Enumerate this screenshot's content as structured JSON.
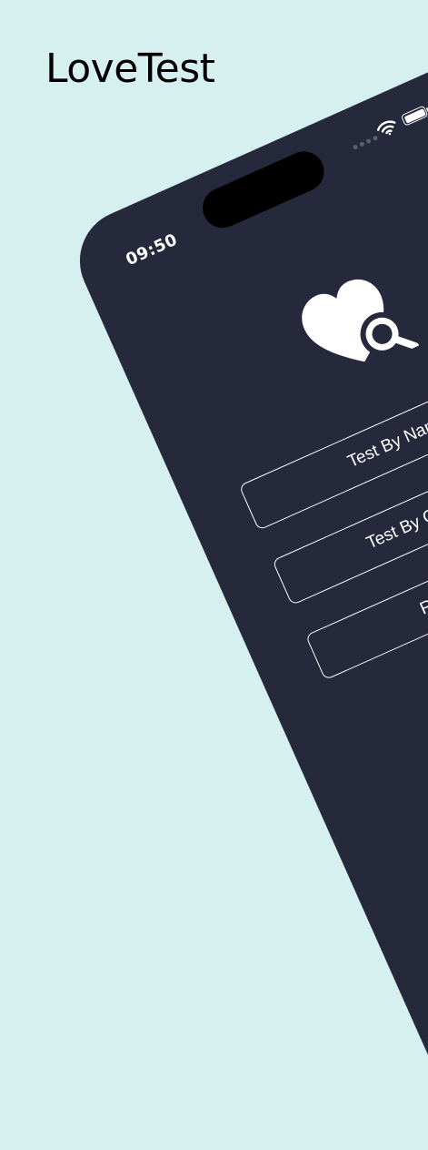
{
  "app": {
    "title": "LoveTest"
  },
  "status_bar": {
    "time": "09:50",
    "battery_percent": 100,
    "icons": [
      "wifi-icon",
      "battery-icon",
      "signal-dots"
    ]
  },
  "logo": {
    "icon": "heart-search-icon"
  },
  "menu": {
    "buttons": [
      {
        "label": "Test By Name"
      },
      {
        "label": "Test By Questions"
      },
      {
        "label": "Relationship"
      }
    ]
  },
  "colors": {
    "background": "#d6efef",
    "phone_body": "#26283b",
    "foreground": "#ffffff"
  }
}
